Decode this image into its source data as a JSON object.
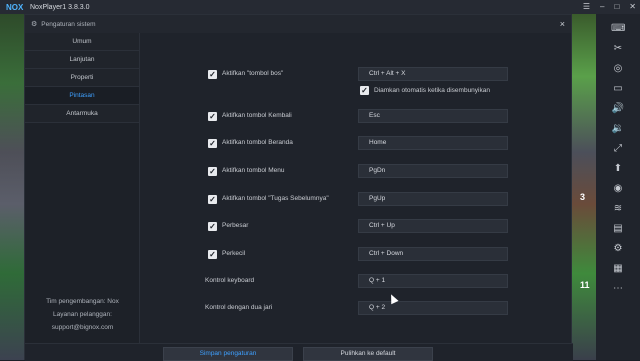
{
  "window": {
    "logo": "NOX",
    "title": "NoxPlayer1 3.8.3.0"
  },
  "dialog": {
    "title": "Pengaturan sistem",
    "close": "×"
  },
  "nav": {
    "items": [
      {
        "label": "Umum",
        "active": false
      },
      {
        "label": "Lanjutan",
        "active": false
      },
      {
        "label": "Properti",
        "active": false
      },
      {
        "label": "Pintasan",
        "active": true
      },
      {
        "label": "Antarmuka",
        "active": false
      }
    ]
  },
  "developer": {
    "line1": "Tim pengembangan: Nox",
    "line2": "Layanan pelanggan:",
    "line3": "support@bignox.com"
  },
  "shortcuts": [
    {
      "label": "Aktifkan \"tombol bos\"",
      "checked": true,
      "key": "Ctrl + Alt + X"
    },
    {
      "label": "Aktifkan tombol Kembali",
      "checked": true,
      "key": "Esc"
    },
    {
      "label": "Aktifkan tombol Beranda",
      "checked": true,
      "key": "Home"
    },
    {
      "label": "Aktifkan tombol Menu",
      "checked": true,
      "key": "PgDn"
    },
    {
      "label": "Aktifkan tombol \"Tugas Sebelumnya\"",
      "checked": true,
      "key": "PgUp"
    },
    {
      "label": "Perbesar",
      "checked": true,
      "key": "Ctrl + Up"
    },
    {
      "label": "Perkecil",
      "checked": true,
      "key": "Ctrl + Down"
    },
    {
      "label": "Kontrol keyboard",
      "checked": null,
      "key": "Q + 1"
    },
    {
      "label": "Kontrol dengan dua jari",
      "checked": null,
      "key": "Q + 2"
    }
  ],
  "boss_sub": {
    "label": "Diamkan otomatis ketika disembunyikan",
    "checked": true
  },
  "footer": {
    "save": "Simpan pengaturan",
    "reset": "Pulihkan ke default"
  },
  "game": {
    "num1": "3",
    "num2": "11"
  },
  "colors": {
    "accent": "#3ea0ff",
    "background": "#1f232b"
  }
}
